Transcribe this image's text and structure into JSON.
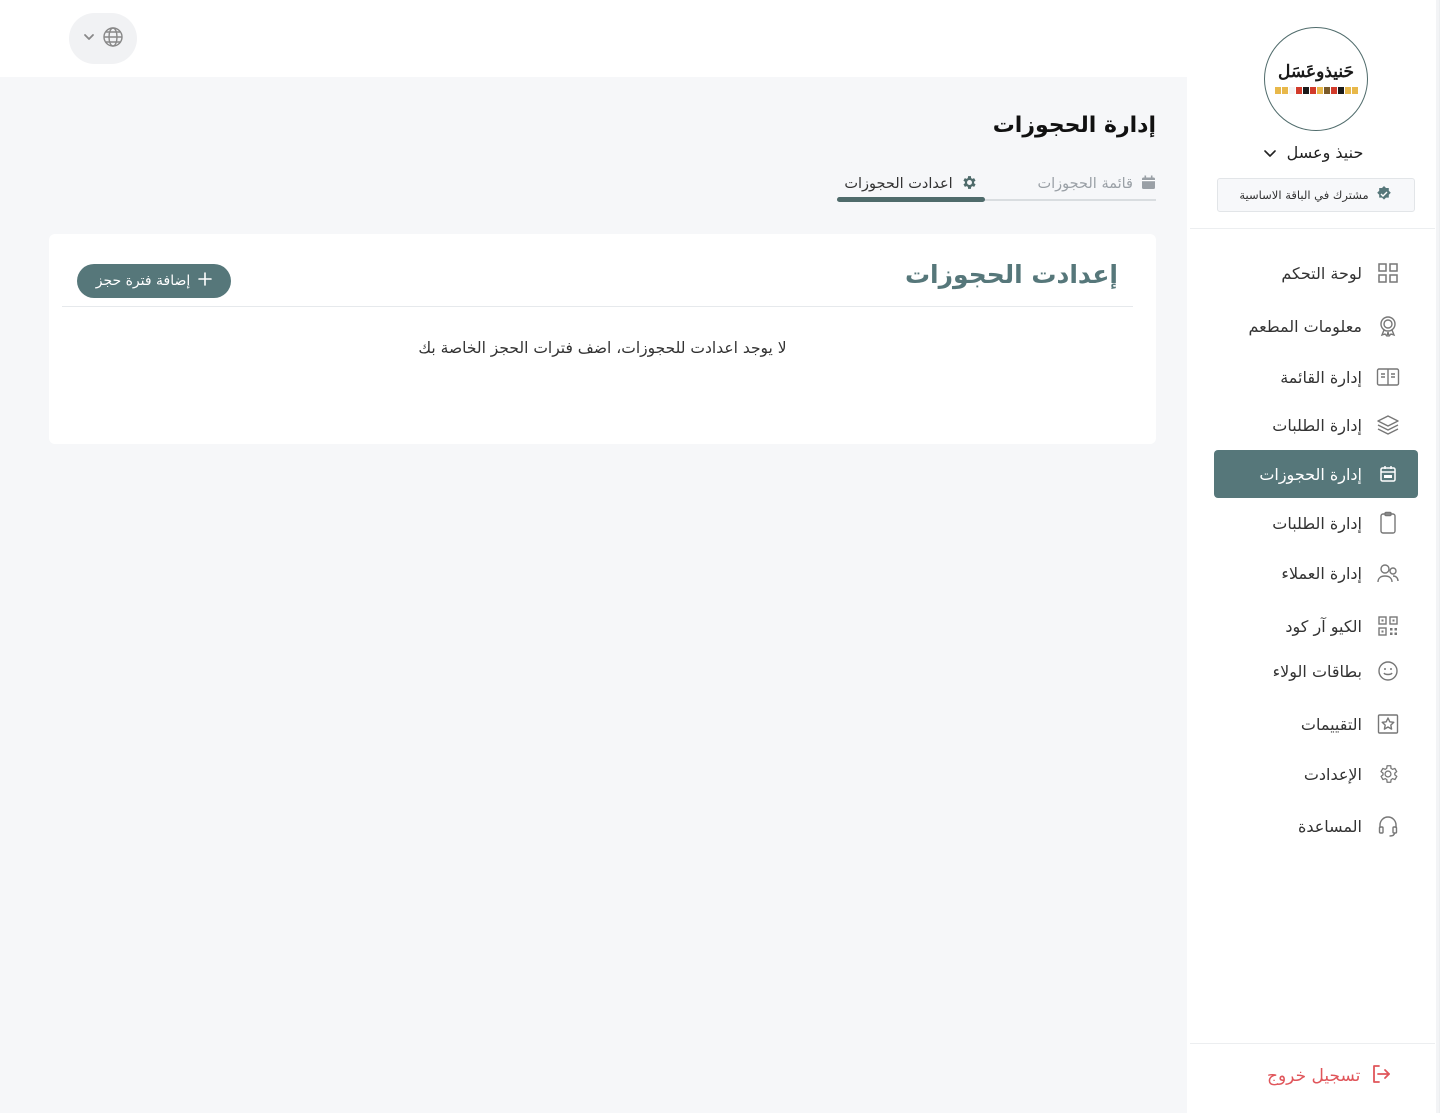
{
  "brand": {
    "logo_text": "حَنيذوعَسَل",
    "name": "حنيذ وعسل",
    "plan_badge": "مشترك في الباقة الاساسية",
    "logo_strip_colors": [
      "#e8b84a",
      "#e8b84a",
      "#f4f4f4",
      "#d23b2b",
      "#1a1a1a",
      "#d23b2b",
      "#e8b84a",
      "#7a5a2a",
      "#d23b2b",
      "#1a1a1a",
      "#e8b84a",
      "#e8b84a"
    ]
  },
  "sidebar": {
    "items": [
      {
        "label": "لوحة التحكم",
        "icon": "dashboard-grid-icon"
      },
      {
        "label": "معلومات المطعم",
        "icon": "restaurant-badge-icon"
      },
      {
        "label": "إدارة القائمة",
        "icon": "menu-book-icon"
      },
      {
        "label": "إدارة الطلبات",
        "icon": "layers-icon"
      },
      {
        "label": "إدارة الحجوزات",
        "icon": "calendar-icon",
        "active": true
      },
      {
        "label": "إدارة الطلبات",
        "icon": "clipboard-icon"
      },
      {
        "label": "إدارة العملاء",
        "icon": "users-icon"
      },
      {
        "label": "الكيو آر كود",
        "icon": "qr-code-icon"
      },
      {
        "label": "بطاقات الولاء",
        "icon": "smiley-icon"
      },
      {
        "label": "التقييمات",
        "icon": "star-icon"
      },
      {
        "label": "الإعدادت",
        "icon": "gear-icon"
      },
      {
        "label": "المساعدة",
        "icon": "headset-icon"
      }
    ],
    "logout_label": "تسجيل خروج"
  },
  "topbar": {
    "language_icon": "globe-icon"
  },
  "main": {
    "page_title": "إدارة الحجوزات",
    "tabs": [
      {
        "label": "قائمة الحجوزات",
        "icon": "calendar-icon"
      },
      {
        "label": "اعدادت الحجوزات",
        "icon": "gear-icon",
        "active": true
      }
    ],
    "card": {
      "title": "إعدادت الحجوزات",
      "add_button_label": "إضافة فترة حجز",
      "empty_message": "لا يوجد اعدادت للحجوزات، اضف فترات الحجز الخاصة بك"
    }
  },
  "colors": {
    "accent": "#56777a",
    "logout": "#e0555a",
    "background": "#f6f7f9"
  }
}
